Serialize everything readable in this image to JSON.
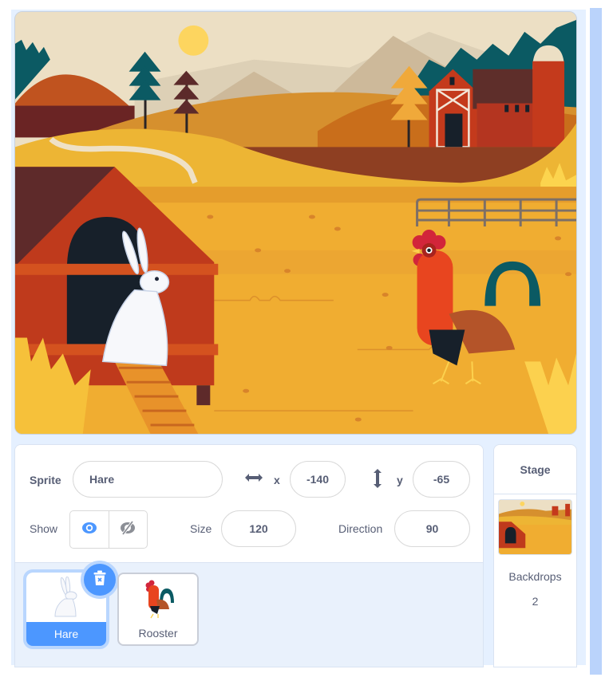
{
  "stage": {
    "backdrop_name": "Farm",
    "sprites_on_stage": [
      "Hare",
      "Rooster"
    ]
  },
  "sprite_info": {
    "sprite_label": "Sprite",
    "sprite_name": "Hare",
    "x_icon": "horizontal-arrows-icon",
    "x_label": "x",
    "x_value": "-140",
    "y_icon": "vertical-arrows-icon",
    "y_label": "y",
    "y_value": "-65",
    "show_label": "Show",
    "show_visible_icon": "eye-icon",
    "show_hidden_icon": "eye-slash-icon",
    "show_state": "visible",
    "size_label": "Size",
    "size_value": "120",
    "direction_label": "Direction",
    "direction_value": "90"
  },
  "sprite_list": {
    "items": [
      {
        "name": "Hare",
        "selected": true
      },
      {
        "name": "Rooster",
        "selected": false
      }
    ],
    "delete_icon": "trash-icon"
  },
  "stage_target": {
    "header": "Stage",
    "backdrops_label": "Backdrops",
    "backdrops_count": "2"
  },
  "colors": {
    "accent": "#4c97ff",
    "accent_halo": "#b9d6fe",
    "text": "#575e75",
    "panel_bg": "#e9f1fc",
    "scrollbar": "#bad3fb"
  }
}
